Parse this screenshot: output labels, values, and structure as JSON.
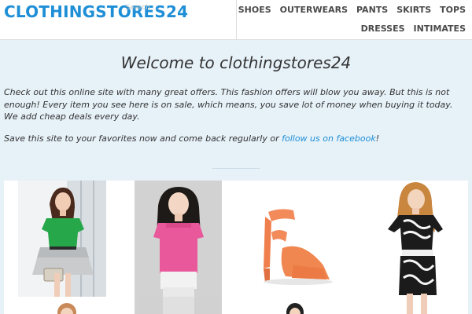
{
  "header": {
    "logo": "CLOTHINGSTORES24",
    "search_placeholder": "Search ...",
    "nav_row1": [
      "SHOES",
      "OUTERWEARS",
      "PANTS",
      "SKIRTS",
      "TOPS"
    ],
    "nav_row2": [
      "DRESSES",
      "INTIMATES"
    ]
  },
  "welcome": {
    "title": "Welcome to clothingstores24",
    "paragraph1": "Check out this online site with many great offers. This fashion offers will blow you away. But this is not enough! Every item you see here is on sale, which means, you save lot of money when buying it today. We add cheap deals every day.",
    "paragraph2_before": "Save this site to your favorites now and come back regularly or ",
    "paragraph2_link": "follow us on facebook",
    "paragraph2_after": "!"
  },
  "products": [
    {
      "name": "green-ruffle-top-grey-skirt-outfit"
    },
    {
      "name": "pink-ruffle-top-outfit"
    },
    {
      "name": "orange-strappy-heel-sandal"
    },
    {
      "name": "black-white-print-dress"
    }
  ],
  "colors": {
    "accent": "#1e8fd6",
    "band_bg": "#e6f1f8",
    "nav_text": "#4a4a4a"
  }
}
